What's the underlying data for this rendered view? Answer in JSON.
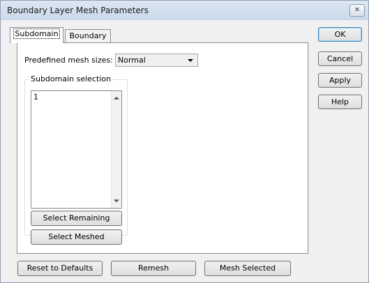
{
  "window": {
    "title": "Boundary Layer Mesh Parameters",
    "close_glyph": "✕"
  },
  "tabs": [
    {
      "label": "Subdomain",
      "active": true
    },
    {
      "label": "Boundary",
      "active": false
    }
  ],
  "subdomain": {
    "predefined_label": "Predefined mesh sizes:",
    "predefined_value": "Normal",
    "selection_group_title": "Subdomain selection",
    "selection_items": [
      "1"
    ],
    "select_remaining_label": "Select Remaining",
    "select_meshed_label": "Select Meshed"
  },
  "side_buttons": {
    "ok": "OK",
    "cancel": "Cancel",
    "apply": "Apply",
    "help": "Help"
  },
  "bottom_buttons": {
    "reset": "Reset to Defaults",
    "remesh": "Remesh",
    "mesh_selected": "Mesh Selected"
  },
  "colors": {
    "title_bar": "#cad9ea",
    "dialog_bg": "#f0f0f0",
    "default_button_border": "#3c7fb1"
  },
  "icons": {
    "close": "close-icon",
    "dropdown": "chevron-down-icon",
    "scroll_up": "scroll-up-icon",
    "scroll_down": "scroll-down-icon"
  }
}
